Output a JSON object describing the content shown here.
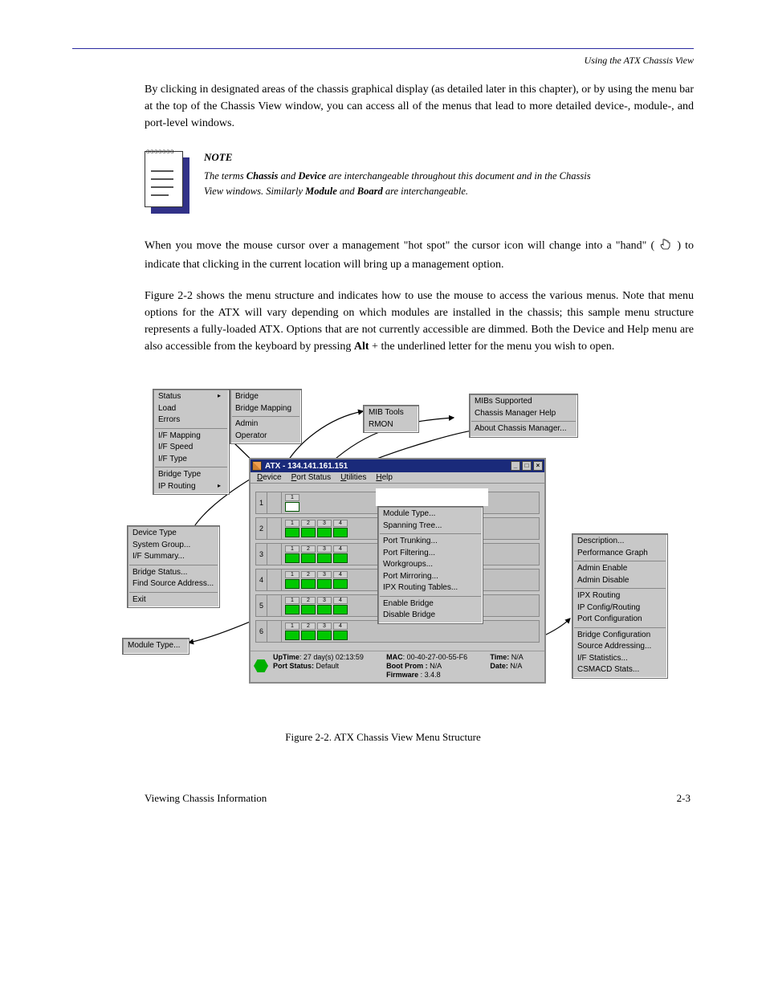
{
  "header_right": "Using the ATX Chassis View",
  "para1": "By clicking in designated areas of the chassis graphical display (as detailed later in this chapter), or by using the menu bar at the top of the Chassis View window, you can access all of the menus that lead to more detailed device-, module-, and port-level windows.",
  "note_label": "NOTE",
  "note_text_a": "The terms ",
  "note_bold_a": "Chassis",
  "note_text_b": " and ",
  "note_bold_b": "Device",
  "note_text_c": " are interchangeable throughout this document and in the Chassis View windows. Similarly ",
  "note_bold_c": "Module",
  "note_text_d": " and ",
  "note_bold_d": "Board",
  "note_text_e": " are interchangeable.",
  "para2_a": "When you move the mouse cursor over a management \"hot spot\" the cursor icon will change into a \"hand\" (",
  "para2_b": ") to indicate that clicking in the current location will bring up a management option.",
  "para3_a": "Figure 2-2 shows the menu structure and indicates how to use the mouse to access the various menus. Note that menu options for the ATX will vary depending on which modules are installed in the chassis; this sample menu structure represents a fully-loaded ATX. Options that are not currently accessible are dimmed. Both the Device and Help menu are also accessible from the keyboard by pressing ",
  "alt_key": "Alt",
  "para3_b": " + the underlined letter for the menu you wish to open.",
  "window_title": "ATX - 134.141.161.151",
  "menubar": {
    "device": "Device",
    "port_status": "Port Status",
    "utilities": "Utilities",
    "help": "Help"
  },
  "win_btns": {
    "min": "_",
    "max": "□",
    "close": "×"
  },
  "device_menu": {
    "items": [
      "Device Type",
      "System Group...",
      "I/F Summary..."
    ],
    "sep1": true,
    "items2": [
      "Bridge Status...",
      "Find Source Address..."
    ],
    "sep2": true,
    "items3": [
      "Exit"
    ]
  },
  "port_status_menu": {
    "items": [
      "Status",
      "Load",
      "Errors"
    ],
    "items2": [
      "I/F Mapping",
      "I/F Speed",
      "I/F Type"
    ],
    "items3": [
      "Bridge Type",
      "IP Routing"
    ]
  },
  "port_status_sub": {
    "items": [
      "Bridge",
      "Bridge Mapping"
    ],
    "items2": [
      "Admin",
      "Operator"
    ]
  },
  "utilities_menu": {
    "items": [
      "MIB Tools",
      "RMON"
    ]
  },
  "help_menu": {
    "items": [
      "MIBs Supported",
      "Chassis Manager Help"
    ],
    "items2": [
      "About Chassis Manager..."
    ]
  },
  "module_menu_label": "Module Type...",
  "module_popup": {
    "items": [
      "Module Type...",
      "Spanning Tree..."
    ],
    "items2": [
      "Port Trunking...",
      "Port Filtering...",
      "Workgroups...",
      "Port Mirroring...",
      "IPX Routing Tables..."
    ],
    "items3": [
      "Enable Bridge",
      "Disable Bridge"
    ]
  },
  "port_menu": {
    "items": [
      "Description...",
      "Performance Graph"
    ],
    "items2": [
      "Admin Enable",
      "Admin Disable"
    ],
    "items3": [
      "IPX Routing",
      "IP  Config/Routing",
      "Port Configuration"
    ],
    "items4": [
      "Bridge Configuration",
      "Source Addressing...",
      "I/F Statistics...",
      "CSMACD Stats..."
    ]
  },
  "slots": [
    {
      "n": "1",
      "ports": 1,
      "leds": [
        ""
      ]
    },
    {
      "n": "2",
      "ports": 4
    },
    {
      "n": "3",
      "ports": 4
    },
    {
      "n": "4",
      "ports": 4
    },
    {
      "n": "5",
      "ports": 4
    },
    {
      "n": "6",
      "ports": 4
    }
  ],
  "status": {
    "uptime_lbl": "UpTime",
    "uptime": ": 27 day(s) 02:13:59",
    "portstatus_lbl": "Port Status:",
    "portstatus": " Default",
    "mac_lbl": "MAC",
    "mac": ": 00-40-27-00-55-F6",
    "boot_lbl": "Boot Prom :",
    "boot": " N/A",
    "fw_lbl": "Firmware",
    "fw": " : 3.4.8",
    "time_lbl": "Time:",
    "time": " N/A",
    "date_lbl": "Date:",
    "date": " N/A"
  },
  "figure_caption": "Figure 2-2. ATX Chassis View Menu Structure",
  "footer_left": "Viewing Chassis Information",
  "footer_right": "2-3"
}
